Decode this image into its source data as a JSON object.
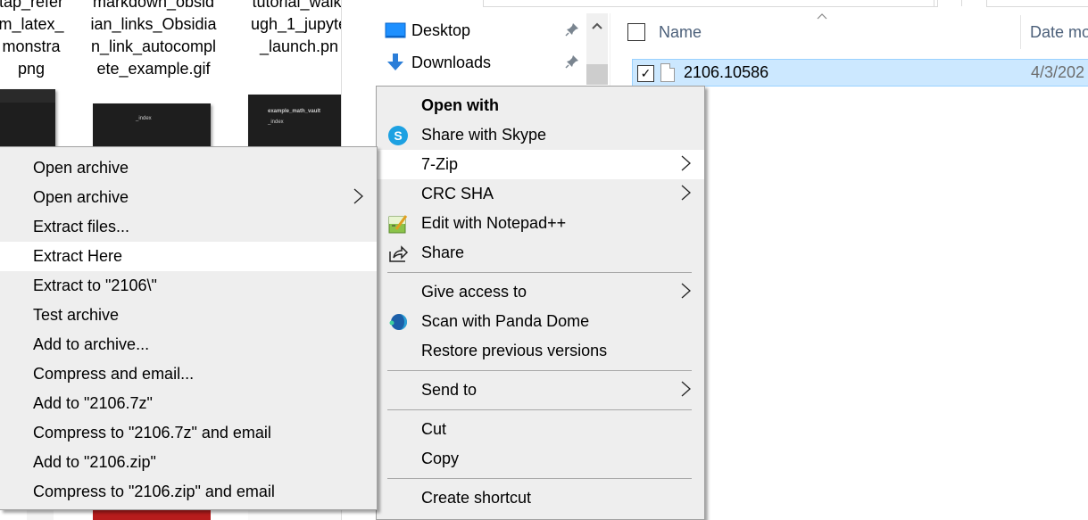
{
  "thumbnails": [
    {
      "caption_lines": [
        "tap_refer",
        "m_latex_",
        "monstra",
        "png"
      ]
    },
    {
      "caption_lines": [
        "markdown_obsid",
        "ian_links_Obsidia",
        "n_link_autocompl",
        "ete_example.gif"
      ],
      "preview_text": "_index"
    },
    {
      "caption_lines": [
        "tutorial_walkt",
        "ugh_1_jupyte",
        "_launch.pn"
      ],
      "preview_title": "example_math_vault",
      "preview_sub": "_index"
    }
  ],
  "explorer": {
    "nav_items": [
      {
        "label": "Desktop",
        "icon": "desktop-icon",
        "pinned": true
      },
      {
        "label": "Downloads",
        "icon": "downloads-icon",
        "pinned": true
      }
    ],
    "columns": {
      "name": "Name",
      "date": "Date mo"
    },
    "files": [
      {
        "name": "2106.10586",
        "date": "4/3/202",
        "selected": true,
        "checked": true
      }
    ],
    "check_mark": "✓"
  },
  "main_menu": {
    "items": [
      {
        "type": "item",
        "label": "Open with",
        "bold": true
      },
      {
        "type": "item",
        "label": "Share with Skype",
        "icon": "skype-icon"
      },
      {
        "type": "item",
        "label": "7-Zip",
        "submenu": true,
        "highlighted": true
      },
      {
        "type": "item",
        "label": "CRC SHA",
        "submenu": true
      },
      {
        "type": "item",
        "label": "Edit with Notepad++",
        "icon": "notepadpp-icon"
      },
      {
        "type": "item",
        "label": "Share",
        "icon": "share-icon"
      },
      {
        "type": "separator"
      },
      {
        "type": "item",
        "label": "Give access to",
        "submenu": true
      },
      {
        "type": "item",
        "label": "Scan with Panda Dome",
        "icon": "panda-dome-icon"
      },
      {
        "type": "item",
        "label": "Restore previous versions"
      },
      {
        "type": "separator"
      },
      {
        "type": "item",
        "label": "Send to",
        "submenu": true
      },
      {
        "type": "separator"
      },
      {
        "type": "item",
        "label": "Cut"
      },
      {
        "type": "item",
        "label": "Copy"
      },
      {
        "type": "separator"
      },
      {
        "type": "item",
        "label": "Create shortcut"
      }
    ]
  },
  "zip_menu": {
    "items": [
      {
        "label": "Open archive"
      },
      {
        "label": "Open archive",
        "submenu": true
      },
      {
        "label": "Extract files..."
      },
      {
        "label": "Extract Here",
        "highlighted": true
      },
      {
        "label": "Extract to \"2106\\\""
      },
      {
        "label": "Test archive"
      },
      {
        "label": "Add to archive..."
      },
      {
        "label": "Compress and email..."
      },
      {
        "label": "Add to \"2106.7z\""
      },
      {
        "label": "Compress to \"2106.7z\" and email"
      },
      {
        "label": "Add to \"2106.zip\""
      },
      {
        "label": "Compress to \"2106.zip\" and email"
      }
    ]
  },
  "colors": {
    "menu_bg": "#eeeeee",
    "menu_hover": "#ffffff",
    "selection_bg": "#cce8ff",
    "selection_border": "#99d1ff",
    "header_text": "#4c607a",
    "skype_blue": "#1da1e2"
  }
}
